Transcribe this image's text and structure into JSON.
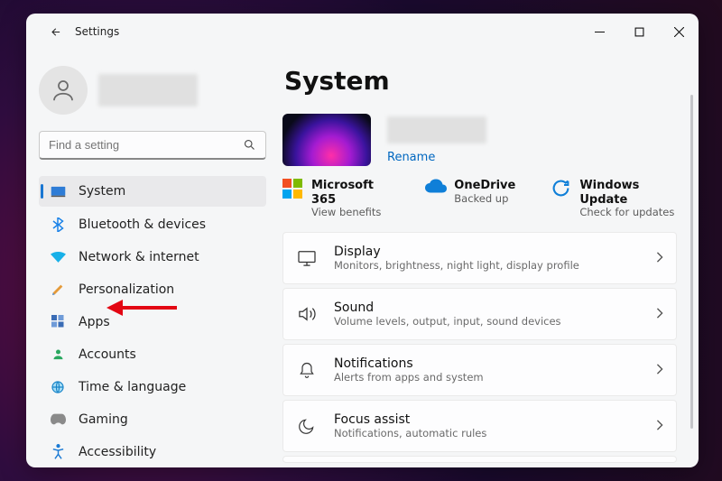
{
  "titlebar": {
    "app_title": "Settings"
  },
  "sidebar": {
    "search_placeholder": "Find a setting",
    "items": [
      {
        "label": "System"
      },
      {
        "label": "Bluetooth & devices"
      },
      {
        "label": "Network & internet"
      },
      {
        "label": "Personalization"
      },
      {
        "label": "Apps"
      },
      {
        "label": "Accounts"
      },
      {
        "label": "Time & language"
      },
      {
        "label": "Gaming"
      },
      {
        "label": "Accessibility"
      }
    ]
  },
  "content": {
    "heading": "System",
    "rename": "Rename",
    "services": [
      {
        "title": "Microsoft 365",
        "subtitle": "View benefits"
      },
      {
        "title": "OneDrive",
        "subtitle": "Backed up"
      },
      {
        "title": "Windows Update",
        "subtitle": "Check for updates"
      }
    ],
    "cards": [
      {
        "title": "Display",
        "subtitle": "Monitors, brightness, night light, display profile"
      },
      {
        "title": "Sound",
        "subtitle": "Volume levels, output, input, sound devices"
      },
      {
        "title": "Notifications",
        "subtitle": "Alerts from apps and system"
      },
      {
        "title": "Focus assist",
        "subtitle": "Notifications, automatic rules"
      }
    ]
  }
}
